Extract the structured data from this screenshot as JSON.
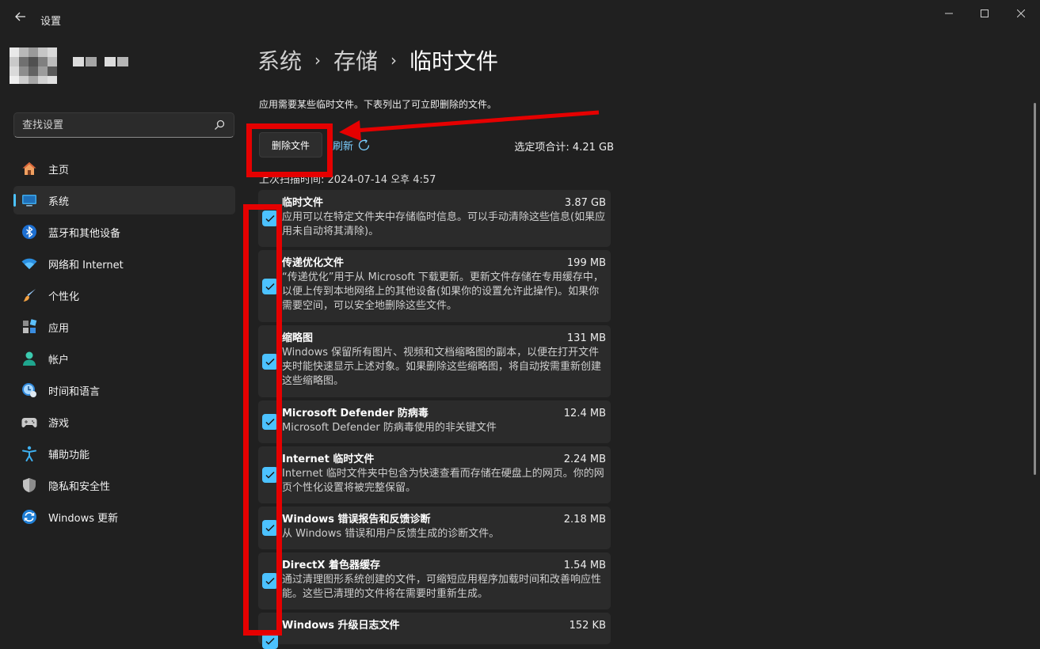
{
  "window": {
    "title": "设置",
    "back_icon": "back-arrow-icon"
  },
  "profile": {
    "name": "■■ ■■"
  },
  "search": {
    "placeholder": "查找设置"
  },
  "sidebar": {
    "items": [
      {
        "label": "主页",
        "icon": "home-icon"
      },
      {
        "label": "系统",
        "icon": "system-display-icon",
        "active": true
      },
      {
        "label": "蓝牙和其他设备",
        "icon": "bluetooth-icon"
      },
      {
        "label": "网络和 Internet",
        "icon": "wifi-icon"
      },
      {
        "label": "个性化",
        "icon": "brush-icon"
      },
      {
        "label": "应用",
        "icon": "apps-icon"
      },
      {
        "label": "帐户",
        "icon": "account-icon"
      },
      {
        "label": "时间和语言",
        "icon": "time-language-icon"
      },
      {
        "label": "游戏",
        "icon": "gamepad-icon"
      },
      {
        "label": "辅助功能",
        "icon": "accessibility-icon"
      },
      {
        "label": "隐私和安全性",
        "icon": "shield-icon"
      },
      {
        "label": "Windows 更新",
        "icon": "update-icon"
      }
    ]
  },
  "breadcrumb": {
    "level1": "系统",
    "level2": "存储",
    "level3": "临时文件",
    "separator": "›"
  },
  "content": {
    "description": "应用需要某些临时文件。下表列出了可立即删除的文件。",
    "delete_button": "删除文件",
    "refresh_label": "刷新",
    "selected_total": "选定项合计: 4.21 GB",
    "last_scan": "上次扫描时间: 2024-07-14 오후 4:57"
  },
  "files": [
    {
      "name": "临时文件",
      "size": "3.87 GB",
      "desc": "应用可以在特定文件夹中存储临时信息。可以手动清除这些信息(如果应用未自动将其清除)。",
      "checked": true
    },
    {
      "name": "传递优化文件",
      "size": "199 MB",
      "desc": "“传递优化”用于从 Microsoft 下载更新。更新文件存储在专用缓存中，以便上传到本地网络上的其他设备(如果你的设置允许此操作)。如果你需要空间，可以安全地删除这些文件。",
      "checked": true
    },
    {
      "name": "缩略图",
      "size": "131 MB",
      "desc": "Windows 保留所有图片、视频和文档缩略图的副本，以便在打开文件夹时能快速显示上述对象。如果删除这些缩略图，将自动按需重新创建这些缩略图。",
      "checked": true
    },
    {
      "name": "Microsoft Defender 防病毒",
      "size": "12.4 MB",
      "desc": "Microsoft Defender 防病毒使用的非关键文件",
      "checked": true
    },
    {
      "name": "Internet 临时文件",
      "size": "2.24 MB",
      "desc": "Internet 临时文件夹中包含为快速查看而存储在硬盘上的网页。你的网页个性化设置将被完整保留。",
      "checked": true
    },
    {
      "name": "Windows 错误报告和反馈诊断",
      "size": "2.18 MB",
      "desc": "从 Windows 错误和用户反馈生成的诊断文件。",
      "checked": true
    },
    {
      "name": "DirectX 着色器缓存",
      "size": "1.54 MB",
      "desc": "通过清理图形系统创建的文件，可缩短应用程序加载时间和改善响应性能。这些已清理的文件将在需要时重新生成。",
      "checked": true
    },
    {
      "name": "Windows 升级日志文件",
      "size": "152 KB",
      "desc": "",
      "checked": true
    }
  ],
  "colors": {
    "accent": "#4cc2ff",
    "annotation": "#e50000",
    "background": "#202020",
    "card": "#2b2b2b"
  }
}
